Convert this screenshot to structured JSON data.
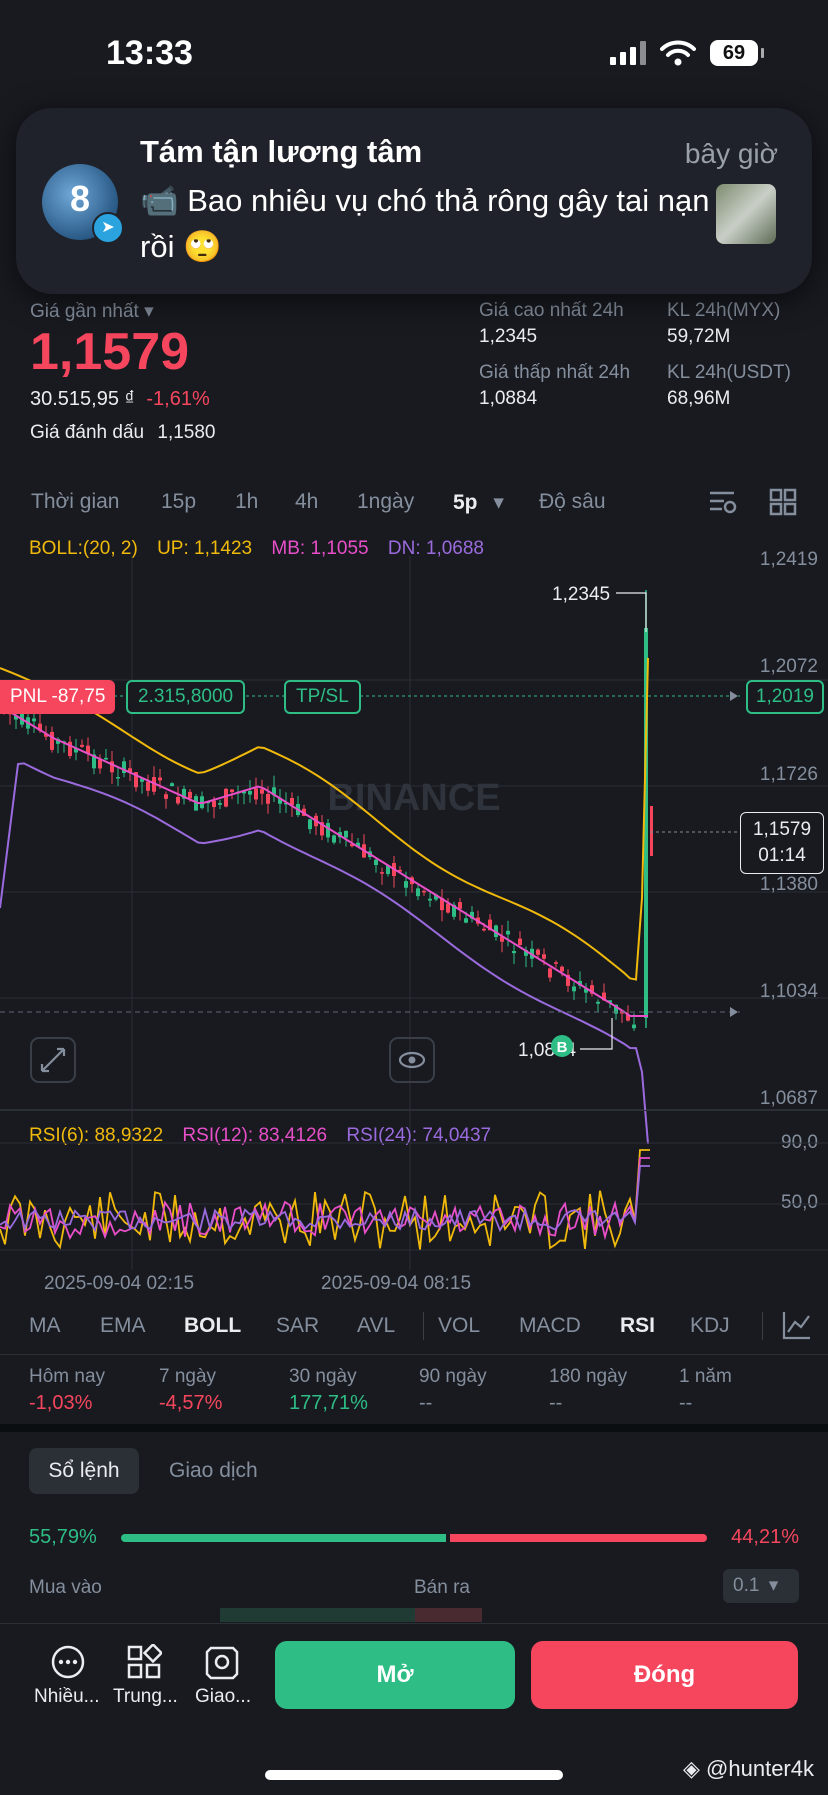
{
  "status": {
    "time": "13:33",
    "battery": "69"
  },
  "notification": {
    "sender": "Tám tận lương tâm",
    "time": "bây giờ",
    "body": "📹 Bao nhiêu vụ chó thả rông gây tai nạn rồi 🙄",
    "avatar_text": "8"
  },
  "ticker": {
    "last_price_label": "Giá gần nhất",
    "last_price": "1,1579",
    "fiat_price": "30.515,95 ₫",
    "change": "-1,61%",
    "mark_label": "Giá đánh dấu",
    "mark_price": "1,1580",
    "high_label": "Giá cao nhất 24h",
    "high": "1,2345",
    "low_label": "Giá thấp nhất 24h",
    "low": "1,0884",
    "vol1_label": "KL 24h(MYX)",
    "vol1": "59,72M",
    "vol2_label": "KL 24h(USDT)",
    "vol2": "68,96M"
  },
  "timeframes": {
    "time": "Thời gian",
    "m15": "15p",
    "h1": "1h",
    "h4": "4h",
    "d1": "1ngày",
    "m5": "5p",
    "depth": "Độ sâu"
  },
  "boll": {
    "label": "BOLL:(20, 2)",
    "up": "UP: 1,1423",
    "mb": "MB: 1,1055",
    "dn": "DN: 1,0688"
  },
  "price_axis": [
    "1,2419",
    "1,2072",
    "1,1726",
    "1,1380",
    "1,1034",
    "1,0687"
  ],
  "chart_marks": {
    "high": "1,2345",
    "low": "1,0884",
    "pnl": "PNL -87,75",
    "entry": "2.315,8000",
    "tpsl": "TP/SL",
    "pnl_price": "1,2019",
    "current": "1,1579",
    "countdown": "01:14",
    "watermark": "BINANCE",
    "buy_marker": "B"
  },
  "rsi": {
    "rsi6": "RSI(6): 88,9322",
    "rsi12": "RSI(12): 83,4126",
    "rsi24": "RSI(24): 74,0437",
    "axis_top": "90,0",
    "axis_mid": "50,0"
  },
  "time_axis": [
    "2025-09-04 02:15",
    "2025-09-04 08:15"
  ],
  "indicators": [
    "MA",
    "EMA",
    "BOLL",
    "SAR",
    "AVL",
    "VOL",
    "MACD",
    "RSI",
    "KDJ"
  ],
  "performance": [
    {
      "label": "Hôm nay",
      "value": "-1,03%"
    },
    {
      "label": "7 ngày",
      "value": "-4,57%"
    },
    {
      "label": "30 ngày",
      "value": "177,71%"
    },
    {
      "label": "90 ngày",
      "value": "--"
    },
    {
      "label": "180 ngày",
      "value": "--"
    },
    {
      "label": "1 năm",
      "value": "--"
    }
  ],
  "orderbook": {
    "tab_book": "Sổ lệnh",
    "tab_trades": "Giao dịch",
    "buy_pct": "55,79%",
    "sell_pct": "44,21%",
    "buy_ratio": 0.5579,
    "buy_label": "Mua vào",
    "sell_label": "Bán ra",
    "step": "0.1"
  },
  "bottom_nav": {
    "more": "Nhiều...",
    "center": "Trung...",
    "trade": "Giao...",
    "open": "Mở",
    "close": "Đóng"
  },
  "watermark_user": "@hunter4k",
  "colors": {
    "green": "#2ebd85",
    "red": "#f6465d",
    "boll_up": "#f0b90b",
    "boll_mb": "#e84fc9",
    "boll_dn": "#9b6bde"
  }
}
